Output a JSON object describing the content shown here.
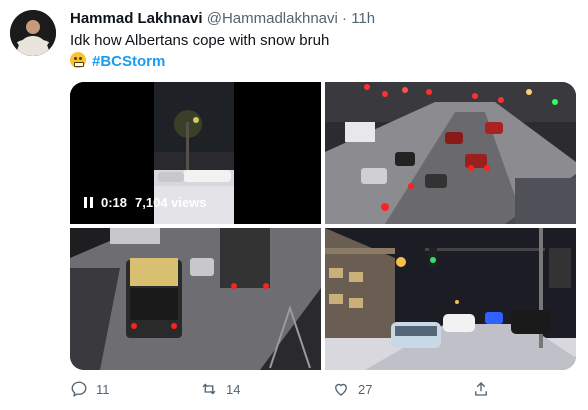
{
  "tweet": {
    "display_name": "Hammad Lakhnavi",
    "handle": "@Hammadlakhnavi",
    "separator": "·",
    "time": "11h",
    "text_line1": "Idk how Albertans cope with snow bruh",
    "emoji_icon": "grinning-face-icon",
    "hashtag": "#BCStorm"
  },
  "media": {
    "video_time": "0:18",
    "video_views": "7,104 views"
  },
  "actions": {
    "reply_count": "11",
    "retweet_count": "14",
    "like_count": "27"
  },
  "colors": {
    "accent": "#1d9bf0",
    "muted": "#536471",
    "text": "#0f1419"
  }
}
